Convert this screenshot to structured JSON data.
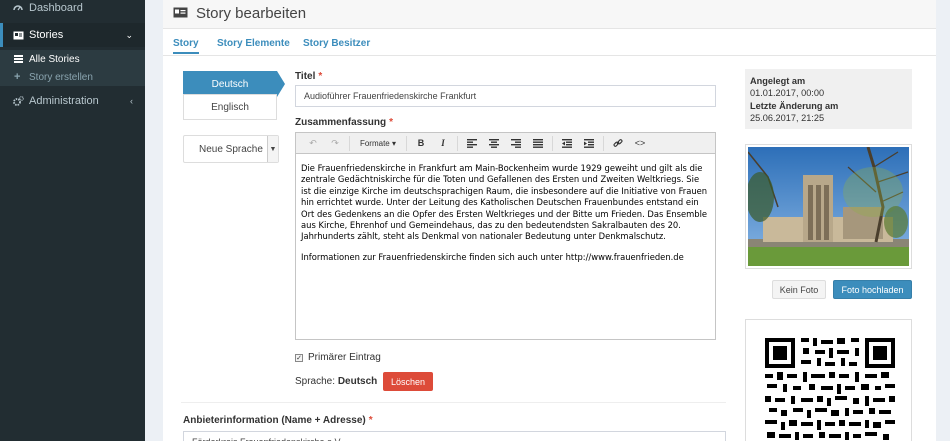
{
  "sidebar": {
    "items": [
      {
        "label": "Dashboard",
        "icon": "dashboard-icon"
      },
      {
        "label": "Stories",
        "icon": "id-card-icon"
      },
      {
        "label": "Administration",
        "icon": "cogs-icon"
      }
    ],
    "subitems": [
      {
        "label": "Alle Stories",
        "icon": "list-icon"
      },
      {
        "label": "Story erstellen",
        "icon": "plus-icon"
      }
    ]
  },
  "header": {
    "title": "Story bearbeiten"
  },
  "tabs": [
    {
      "label": "Story"
    },
    {
      "label": "Story Elemente"
    },
    {
      "label": "Story Besitzer"
    }
  ],
  "languages": {
    "items": [
      "Deutsch",
      "Englisch"
    ],
    "active": "Deutsch",
    "new_language_select": "Neue Sprache"
  },
  "form": {
    "title_label": "Titel",
    "title_value": "Audioführer Frauenfriedenskirche Frankfurt",
    "summary_label": "Zusammenfassung",
    "required_mark": "*",
    "toolbar": {
      "format_label": "Formate"
    },
    "summary_paragraphs": [
      "Die Frauenfriedenskirche in Frankfurt am Main-Bockenheim wurde 1929 geweiht und gilt als die zentrale Gedächtniskirche für die Toten und Gefallenen des Ersten und Zweiten Weltkriegs. Sie ist die einzige Kirche im deutschsprachigen Raum, die insbesondere auf die Initiative von Frauen hin errichtet wurde. Unter der Leitung des Katholischen Deutschen Frauenbundes entstand ein Ort des Gedenkens an die Opfer des Ersten Weltkrieges und der Bitte um Frieden. Das Ensemble aus Kirche, Ehrenhof und Gemeindehaus, das zu den bedeutendsten Sakralbauten des 20. Jahrhunderts zählt, steht als Denkmal von nationaler Bedeutung unter Denkmalschutz.",
      "Informationen zur Frauenfriedenskirche finden sich auch unter http://www.frauenfrieden.de"
    ],
    "primary_checkbox_label": "Primärer Eintrag",
    "language_label": "Sprache:",
    "language_value": "Deutsch",
    "delete_button": "Löschen",
    "provider_label": "Anbieterinformation (Name + Adresse)",
    "provider_value": "Förderkreis Frauenfriedenskirche e.V."
  },
  "meta": {
    "created_label": "Angelegt am",
    "created_value": "01.01.2017, 00:00",
    "modified_label": "Letzte Änderung am",
    "modified_value": "25.06.2017, 21:25"
  },
  "photo_actions": {
    "no_photo": "Kein Foto",
    "upload": "Foto hochladen"
  },
  "colors": {
    "accent": "#3c8dbc",
    "danger": "#dd4b39",
    "sidebar": "#222d32"
  }
}
